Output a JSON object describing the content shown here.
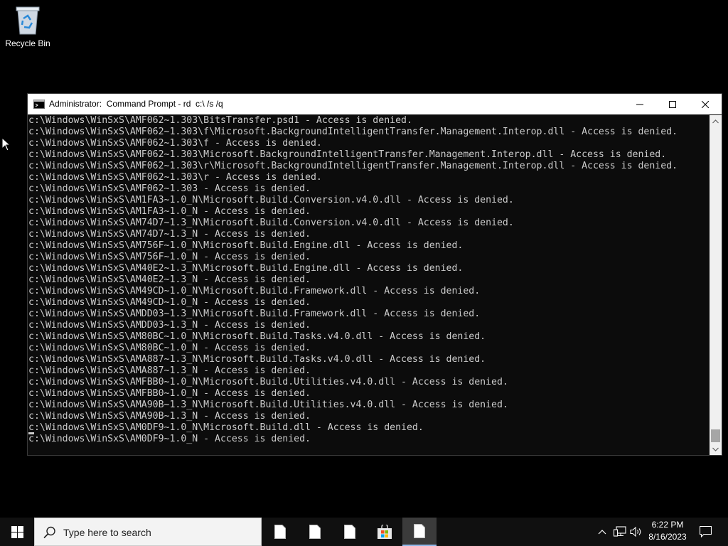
{
  "desktop": {
    "icons": [
      {
        "label": "Recycle Bin",
        "icon": "recycle-bin-icon"
      }
    ]
  },
  "window": {
    "title": "Administrator:  Command Prompt - rd  c:\\ /s /q",
    "controls": {
      "minimize": "minimize-icon",
      "maximize": "maximize-icon",
      "close": "close-icon"
    },
    "lines": [
      "c:\\Windows\\WinSxS\\AMF062~1.303\\BitsTransfer.psd1 - Access is denied.",
      "c:\\Windows\\WinSxS\\AMF062~1.303\\f\\Microsoft.BackgroundIntelligentTransfer.Management.Interop.dll - Access is denied.",
      "c:\\Windows\\WinSxS\\AMF062~1.303\\f - Access is denied.",
      "c:\\Windows\\WinSxS\\AMF062~1.303\\Microsoft.BackgroundIntelligentTransfer.Management.Interop.dll - Access is denied.",
      "c:\\Windows\\WinSxS\\AMF062~1.303\\r\\Microsoft.BackgroundIntelligentTransfer.Management.Interop.dll - Access is denied.",
      "c:\\Windows\\WinSxS\\AMF062~1.303\\r - Access is denied.",
      "c:\\Windows\\WinSxS\\AMF062~1.303 - Access is denied.",
      "c:\\Windows\\WinSxS\\AM1FA3~1.0_N\\Microsoft.Build.Conversion.v4.0.dll - Access is denied.",
      "c:\\Windows\\WinSxS\\AM1FA3~1.0_N - Access is denied.",
      "c:\\Windows\\WinSxS\\AM74D7~1.3_N\\Microsoft.Build.Conversion.v4.0.dll - Access is denied.",
      "c:\\Windows\\WinSxS\\AM74D7~1.3_N - Access is denied.",
      "c:\\Windows\\WinSxS\\AM756F~1.0_N\\Microsoft.Build.Engine.dll - Access is denied.",
      "c:\\Windows\\WinSxS\\AM756F~1.0_N - Access is denied.",
      "c:\\Windows\\WinSxS\\AM40E2~1.3_N\\Microsoft.Build.Engine.dll - Access is denied.",
      "c:\\Windows\\WinSxS\\AM40E2~1.3_N - Access is denied.",
      "c:\\Windows\\WinSxS\\AM49CD~1.0_N\\Microsoft.Build.Framework.dll - Access is denied.",
      "c:\\Windows\\WinSxS\\AM49CD~1.0_N - Access is denied.",
      "c:\\Windows\\WinSxS\\AMDD03~1.3_N\\Microsoft.Build.Framework.dll - Access is denied.",
      "c:\\Windows\\WinSxS\\AMDD03~1.3_N - Access is denied.",
      "c:\\Windows\\WinSxS\\AM80BC~1.0_N\\Microsoft.Build.Tasks.v4.0.dll - Access is denied.",
      "c:\\Windows\\WinSxS\\AM80BC~1.0_N - Access is denied.",
      "c:\\Windows\\WinSxS\\AMA887~1.3_N\\Microsoft.Build.Tasks.v4.0.dll - Access is denied.",
      "c:\\Windows\\WinSxS\\AMA887~1.3_N - Access is denied.",
      "c:\\Windows\\WinSxS\\AMFBB0~1.0_N\\Microsoft.Build.Utilities.v4.0.dll - Access is denied.",
      "c:\\Windows\\WinSxS\\AMFBB0~1.0_N - Access is denied.",
      "c:\\Windows\\WinSxS\\AMA90B~1.3_N\\Microsoft.Build.Utilities.v4.0.dll - Access is denied.",
      "c:\\Windows\\WinSxS\\AMA90B~1.3_N - Access is denied.",
      "c:\\Windows\\WinSxS\\AM0DF9~1.0_N\\Microsoft.Build.dll - Access is denied.",
      "c:\\Windows\\WinSxS\\AM0DF9~1.0_N - Access is denied."
    ]
  },
  "taskbar": {
    "search_placeholder": "Type here to search",
    "apps": [
      "file-icon",
      "file-icon",
      "file-icon",
      "store-icon",
      "file-icon"
    ],
    "tray": [
      "chevron-up-icon",
      "network-icon",
      "volume-icon"
    ],
    "time": "6:22 PM",
    "date": "8/16/2023",
    "notification": "notification-icon"
  }
}
